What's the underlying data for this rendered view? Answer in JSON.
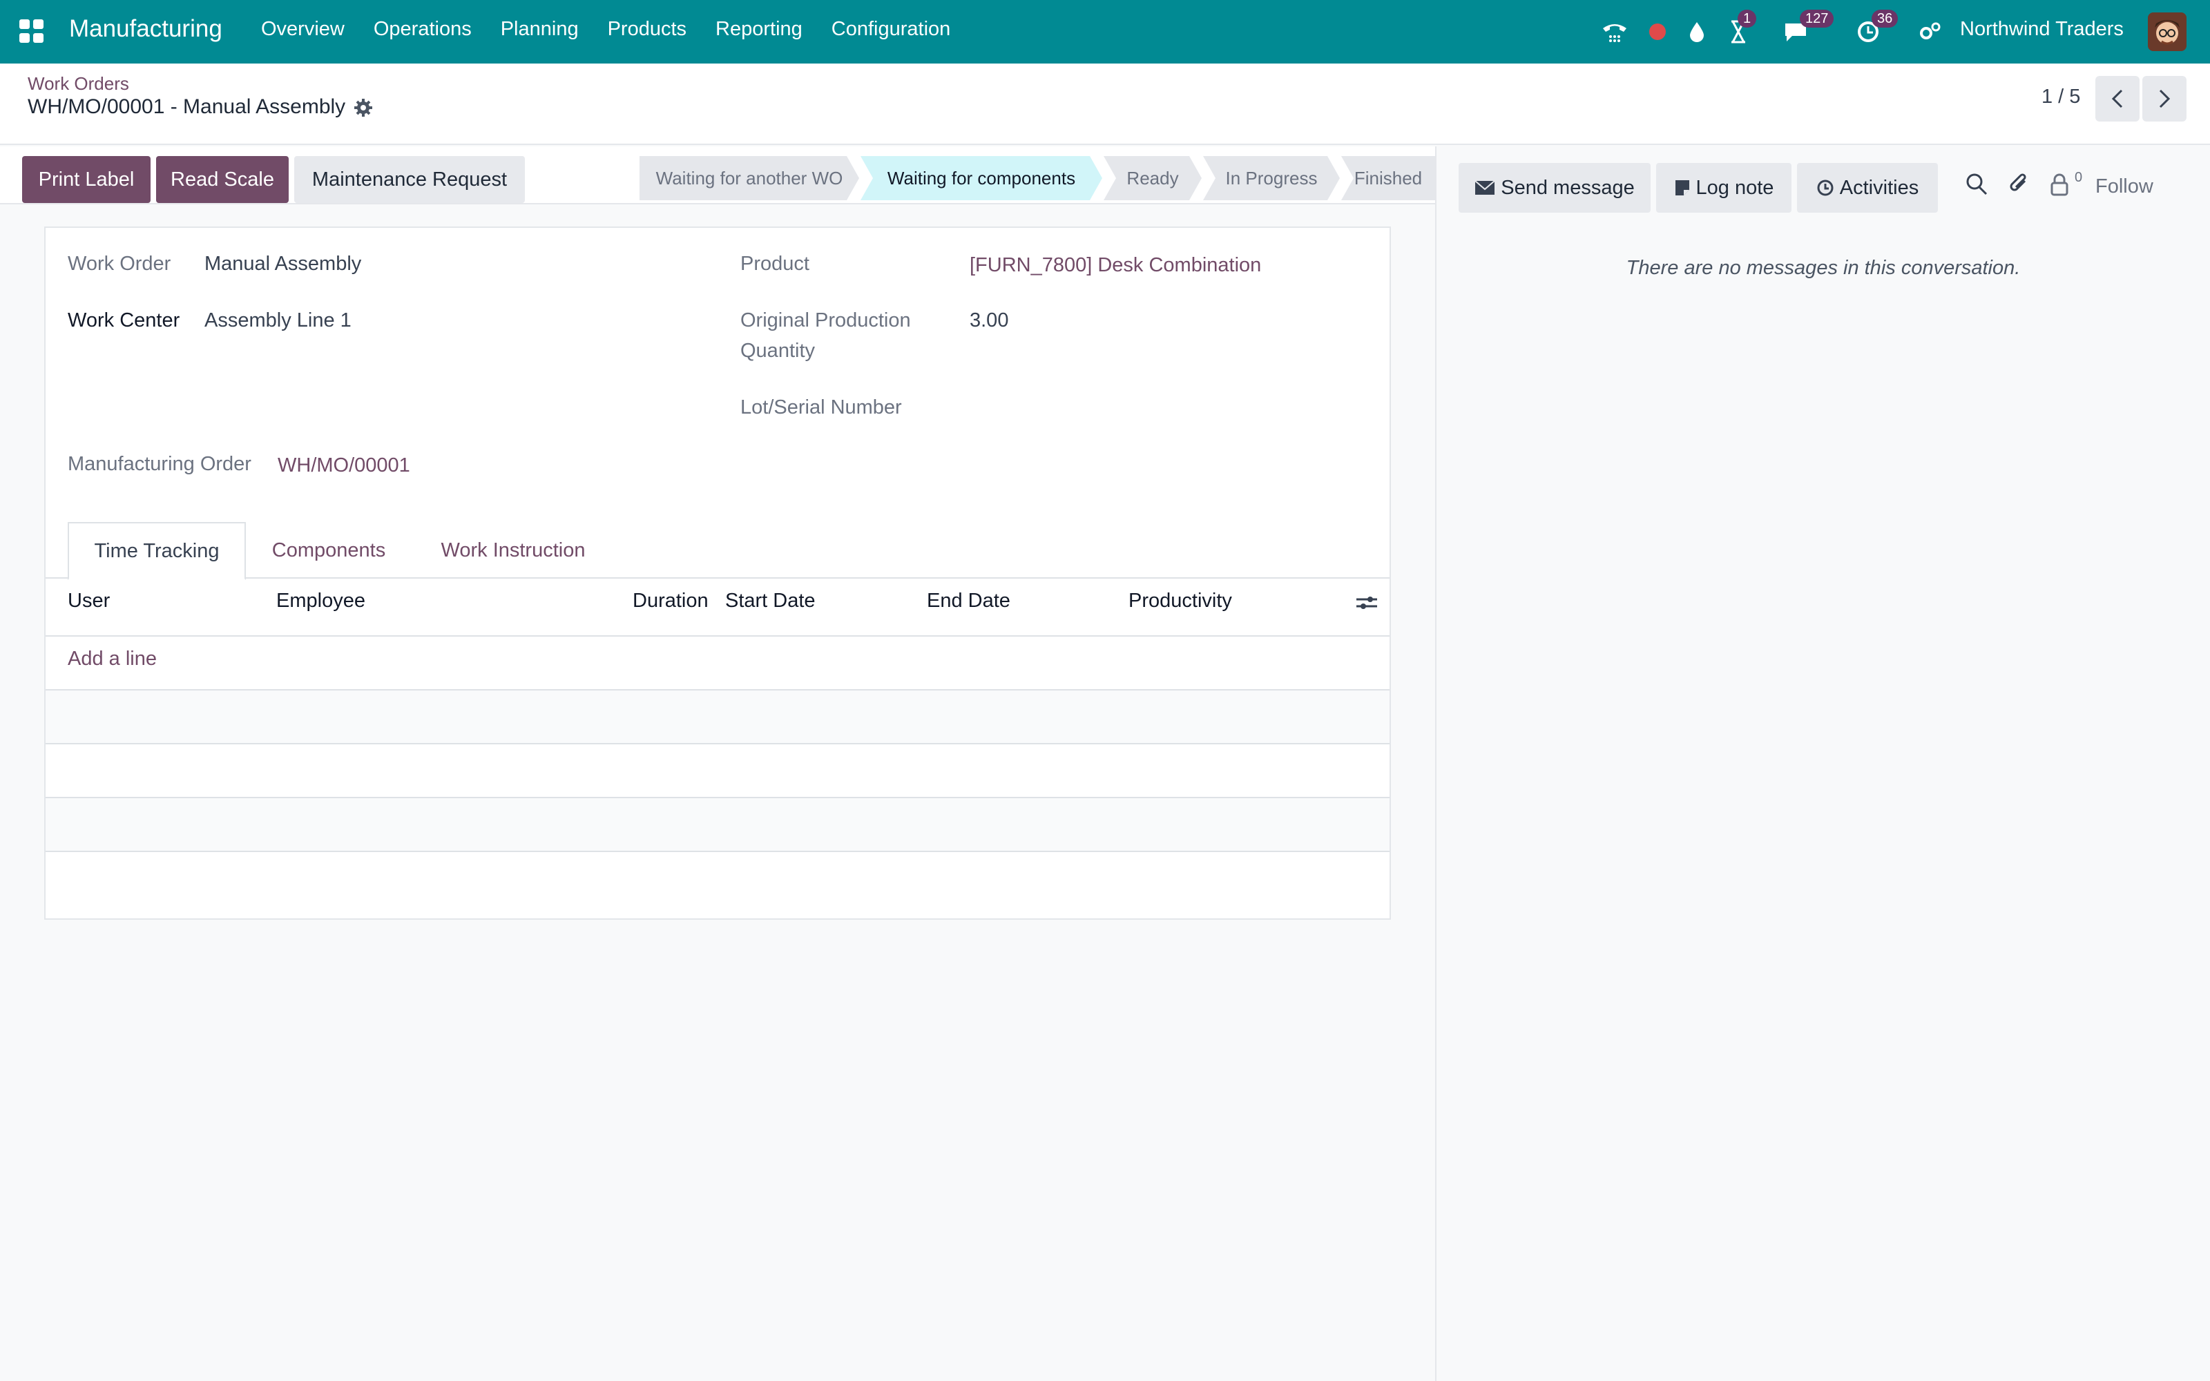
{
  "navbar": {
    "app_name": "Manufacturing",
    "menu": [
      "Overview",
      "Operations",
      "Planning",
      "Products",
      "Reporting",
      "Configuration"
    ],
    "badges": {
      "activities_timer": "1",
      "messages": "127",
      "activities": "36"
    },
    "company": "Northwind Traders",
    "icons": [
      "apps-grid-icon",
      "phone-icon",
      "record-dot-icon",
      "drop-icon",
      "hourglass-icon",
      "chat-icon",
      "clock-icon",
      "settings-icon"
    ],
    "colors": {
      "bar": "#018a93",
      "badge": "#6b3467",
      "record": "#e04a4a"
    }
  },
  "breadcrumb": {
    "parent": "Work Orders",
    "current": "WH/MO/00001 - Manual Assembly"
  },
  "pager": {
    "value": "1 / 5"
  },
  "actions": {
    "print_label": "Print Label",
    "read_scale": "Read Scale",
    "maintenance_request": "Maintenance Request"
  },
  "stages": [
    {
      "label": "Waiting for another WO",
      "active": false
    },
    {
      "label": "Waiting for components",
      "active": true
    },
    {
      "label": "Ready",
      "active": false
    },
    {
      "label": "In Progress",
      "active": false
    },
    {
      "label": "Finished",
      "active": false
    }
  ],
  "form": {
    "work_order_label": "Work Order",
    "work_order_value": "Manual Assembly",
    "work_center_label": "Work Center",
    "work_center_value": "Assembly Line 1",
    "product_label": "Product",
    "product_value": "[FURN_7800] Desk Combination",
    "orig_qty_label_1": "Original Production",
    "orig_qty_label_2": "Quantity",
    "orig_qty_value": "3.00",
    "lot_label": "Lot/Serial Number",
    "mo_label": "Manufacturing Order",
    "mo_value": "WH/MO/00001"
  },
  "tabs": [
    {
      "label": "Time Tracking",
      "active": true
    },
    {
      "label": "Components",
      "active": false
    },
    {
      "label": "Work Instruction",
      "active": false
    }
  ],
  "table": {
    "columns": [
      "User",
      "Employee",
      "Duration",
      "Start Date",
      "End Date",
      "Productivity"
    ],
    "add_line": "Add a line"
  },
  "chatter": {
    "send_message": "Send message",
    "log_note": "Log note",
    "activities": "Activities",
    "follower_count": "0",
    "follow": "Follow",
    "empty": "There are no messages in this conversation."
  },
  "colors": {
    "accent": "#714b67",
    "stage_active": "#d1f5f9"
  }
}
